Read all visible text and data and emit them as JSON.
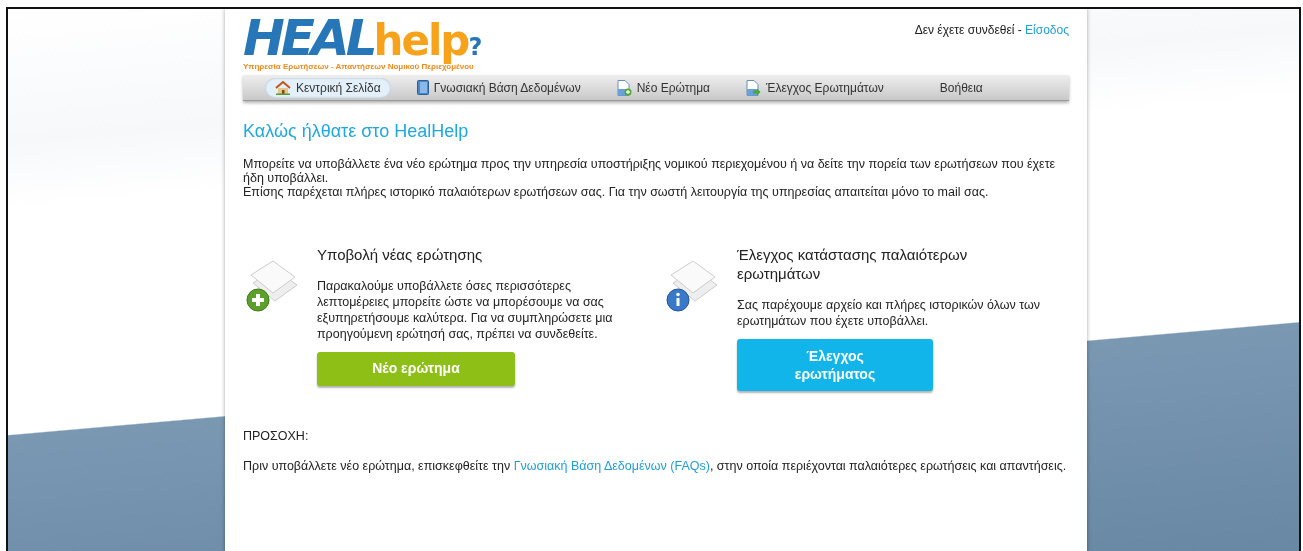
{
  "logo": {
    "part_1": "HEAL",
    "part_2": "help",
    "mark": "?",
    "tagline": "Υπηρεσία Ερωτήσεων - Απαντήσεων Νομικού Περιεχομένου"
  },
  "login": {
    "status": "Δεν έχετε συνδεθεί -",
    "link": "Είσοδος"
  },
  "nav": [
    {
      "label": "Κεντρική Σελίδα",
      "kind": "home",
      "selected": true
    },
    {
      "label": "Γνωσιακή Βάση Δεδομένων",
      "kind": "book",
      "selected": false
    },
    {
      "label": "Νέο Ερώτημα",
      "kind": "new",
      "selected": false
    },
    {
      "label": "Έλεγχος Ερωτημάτων",
      "kind": "check",
      "selected": false
    },
    {
      "label": "Βοήθεια",
      "kind": "plain",
      "selected": false
    }
  ],
  "heading": "Καλώς ήλθατε στο HealHelp",
  "intro": [
    "Μπορείτε να υποβάλλετε ένα νέο ερώτημα προς την υπηρεσία υποστήριξης νομικού περιεχομένου ή να δείτε την πορεία των ερωτήσεων που έχετε ήδη υποβάλλει.",
    "Επίσης παρέχεται πλήρες ιστορικό παλαιότερων ερωτήσεων σας. Για την σωστή λειτουργία της υπηρεσίας απαιτείται μόνο το mail σας."
  ],
  "sections": [
    {
      "kind": "new",
      "title": "Υποβολή νέας ερώτησης",
      "text": "Παρακαλούμε υποβάλλετε όσες περισσότερες λεπτομέρειες μπορείτε ώστε να μπορέσουμε να σας εξυπηρετήσουμε καλύτερα. Για να συμπληρώσετε μια προηγούμενη ερώτησή σας, πρέπει να συνδεθείτε.",
      "button": "Νέο ερώτημα"
    },
    {
      "kind": "check",
      "title": "Έλεγχος κατάστασης παλαιότερων ερωτημάτων",
      "text": "Σας παρέχουμε αρχείο και πλήρες ιστορικών όλων των ερωτημάτων που έχετε υποβάλλει.",
      "button": "Έλεγχος ερωτήματος"
    }
  ],
  "notice": {
    "title": "ΠΡΟΣΟΧΗ:",
    "before": "Πριν υποβάλλετε νέο ερώτημα, επισκεφθείτε την",
    "link": "Γνωσιακή Βάση Δεδομένων (FAQs)",
    "after": ", στην οποία περιέχονται παλαιότερες ερωτήσεις και απαντήσεις."
  }
}
